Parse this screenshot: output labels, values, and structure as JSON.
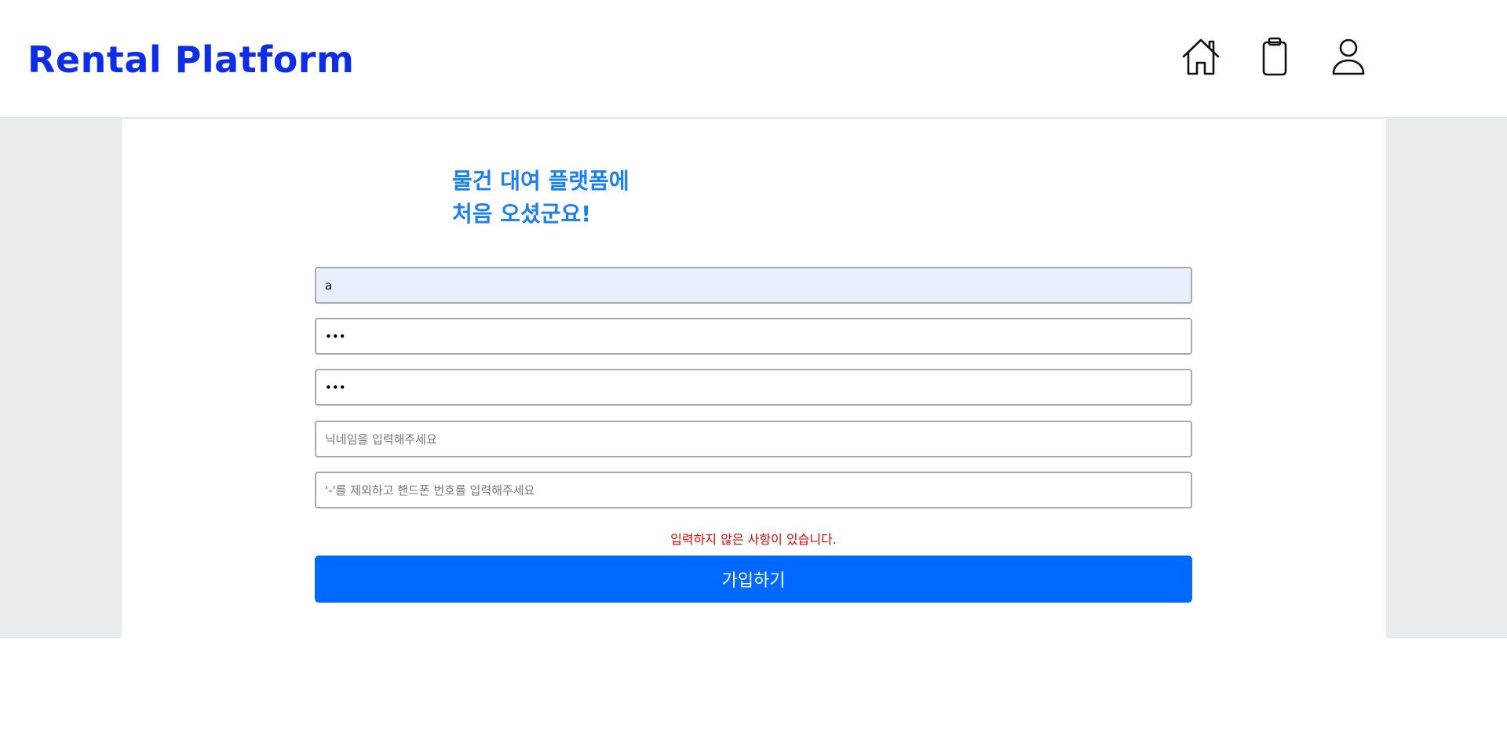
{
  "header": {
    "brand": "Rental Platform",
    "nav": [
      {
        "name": "home-icon"
      },
      {
        "name": "clipboard-icon"
      },
      {
        "name": "user-icon"
      }
    ],
    "brand_color": "#0d2ee6"
  },
  "form": {
    "title_line1": "물건 대여 플랫폼에",
    "title_line2": "처음 오셨군요!",
    "fields": {
      "id_value": "a",
      "password_value": "•••",
      "password_confirm_value": "•••",
      "nickname_placeholder": "닉네임을 입력해주세요",
      "phone_placeholder": "'-'를 제외하고 핸드폰 번호를 입력해주세요"
    },
    "error_message": "입력하지 않은 사항이 있습니다.",
    "submit_label": "가입하기"
  },
  "colors": {
    "accent": "#1a7ff0",
    "button": "#0069ff",
    "error": "#e60000",
    "page_background": "#e9ecef"
  }
}
